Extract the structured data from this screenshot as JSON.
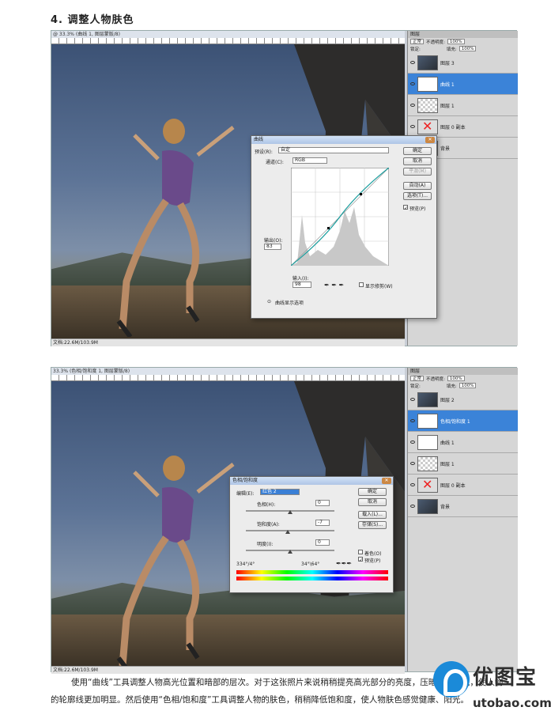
{
  "heading": "4.  调整人物肤色",
  "shot1": {
    "doc_title": "@ 33.3% (曲线 1, 图层蒙版/8)",
    "status": "文档:22.6M/103.9M",
    "layers_panel": {
      "tab": "图层",
      "blend_mode": "正常",
      "opacity_label": "不透明度:",
      "opacity": "100%",
      "lock_label": "锁定:",
      "fill_label": "填充:",
      "fill": "100%",
      "layers": [
        {
          "name": "图层 3",
          "thumb": "dark",
          "selected": false
        },
        {
          "name": "曲线 1",
          "thumb": "white",
          "selected": true
        },
        {
          "name": "图层 1",
          "thumb": "check",
          "selected": false
        },
        {
          "name": "图层 0 副本",
          "thumb": "redx",
          "selected": false
        },
        {
          "name": "背景",
          "thumb": "dark",
          "selected": false
        }
      ]
    },
    "curves_dialog": {
      "title": "曲线",
      "preset_label": "预设(R):",
      "preset_value": "自定",
      "channel_label": "通道(C):",
      "channel_value": "RGB",
      "output_label": "输出(O):",
      "output_value": "83",
      "input_label": "输入(I):",
      "input_value": "98",
      "show_clipping": "显示修剪(W)",
      "curve_options": "曲线显示选项",
      "buttons": [
        "确定",
        "取消",
        "平滑(M)",
        "自动(A)",
        "选项(T)..."
      ],
      "preview": "预览(P)"
    }
  },
  "shot2": {
    "doc_title": "33.3% (色相/饱和度 1, 图层蒙版/8)",
    "status": "文档:22.6M/103.9M",
    "layers_panel": {
      "tab": "图层",
      "blend_mode": "正常",
      "opacity_label": "不透明度:",
      "opacity": "100%",
      "lock_label": "锁定:",
      "fill_label": "填充:",
      "fill": "100%",
      "layers": [
        {
          "name": "图层 2",
          "thumb": "dark",
          "selected": false
        },
        {
          "name": "色相/饱和度 1",
          "thumb": "white",
          "selected": true
        },
        {
          "name": "曲线 1",
          "thumb": "white",
          "selected": false
        },
        {
          "name": "图层 1",
          "thumb": "check",
          "selected": false
        },
        {
          "name": "图层 0 副本",
          "thumb": "redx",
          "selected": false
        },
        {
          "name": "背景",
          "thumb": "dark",
          "selected": false
        }
      ]
    },
    "hue_dialog": {
      "title": "色相/饱和度",
      "edit_label": "编辑(E):",
      "edit_value": "红色 2",
      "hue_label": "色相(H):",
      "hue_value": "0",
      "sat_label": "饱和度(A):",
      "sat_value": "-7",
      "light_label": "明度(I):",
      "light_value": "0",
      "range_left": "334°/4°",
      "range_right": "34°\\64°",
      "colorize": "着色(O)",
      "preview": "预览(P)",
      "buttons": [
        "确定",
        "取消",
        "载入(L)...",
        "存储(S)..."
      ]
    }
  },
  "paragraph": "使用“曲线”工具调整人物高光位置和暗部的层次。对于这张照片来说稍稍提亮高光部分的亮度，压暗暗部区域，使人物的轮廓线更加明显。然后使用“色相/饱和度”工具调整人物的肤色，稍稍降低饱和度，使人物肤色感觉健康、阳光。",
  "watermark": {
    "cn": "优图宝",
    "en": "utobao.com"
  }
}
